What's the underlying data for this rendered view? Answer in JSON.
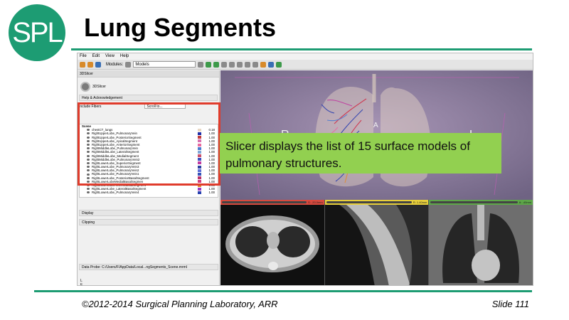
{
  "slide": {
    "logo_text": "SPL",
    "title": "Lung Segments",
    "footer_left": "©2012-2014 Surgical Planning Laboratory, ARR",
    "footer_right": "Slide 111"
  },
  "callout": {
    "text": "Slicer displays the list of 15 surface models of pulmonary structures."
  },
  "app": {
    "menu": [
      "File",
      "Edit",
      "View",
      "Help"
    ],
    "toolbar": {
      "modules_label": "Modules:",
      "module_selected": "Models"
    },
    "left_panel": {
      "header": "3DSlicer",
      "module_logo_label": "3DSlicer",
      "help_section": "Help & Acknowledgement",
      "filter_label": "Include Fibers",
      "filter_placeholder": "Scroll to...",
      "models": [
        {
          "name": "Scene",
          "opacity": "",
          "color": ""
        },
        {
          "name": "chestCT_lungs",
          "opacity": "0.18",
          "color": "#e8d7c4"
        },
        {
          "name": "RightUpperLobe_PulmonaryVein",
          "opacity": "1.00",
          "color": "#1f2fa8"
        },
        {
          "name": "RightUpperLobe_PosteriorSegment",
          "opacity": "1.00",
          "color": "#c23c3c"
        },
        {
          "name": "RightUpperLobe_ApicalSegment",
          "opacity": "1.00",
          "color": "#d870b0"
        },
        {
          "name": "RightUpperLobe_AnteriorSegment",
          "opacity": "1.00",
          "color": "#e86aa0"
        },
        {
          "name": "RightMiddleLobe_PulmonaryVein",
          "opacity": "1.00",
          "color": "#4a7bd0"
        },
        {
          "name": "RightMiddleLobe_LateralSegment",
          "opacity": "1.00",
          "color": "#7fa8d8"
        },
        {
          "name": "RightMiddleLobe_MedialSegment",
          "opacity": "1.00",
          "color": "#c9506c"
        },
        {
          "name": "RightMiddleLobe_PulmonaryVein2",
          "opacity": "1.00",
          "color": "#3b4fc0"
        },
        {
          "name": "RightLowerLobe_SuperiorSegment",
          "opacity": "1.00",
          "color": "#c03aa0"
        },
        {
          "name": "RightLowerLobe_PulmonaryVein3",
          "opacity": "1.00",
          "color": "#2d3fa0"
        },
        {
          "name": "RightLowerLobe_PulmonaryVein2",
          "opacity": "1.00",
          "color": "#5d6fd8"
        },
        {
          "name": "RightLowerLobe_PulmonaryVein1",
          "opacity": "1.00",
          "color": "#3552b8"
        },
        {
          "name": "RightLowerLobe_PosteriorBasalSegment",
          "opacity": "1.00",
          "color": "#b8306a"
        },
        {
          "name": "RightLowerLobeMedialBasalSegmen",
          "opacity": "1.00",
          "color": "#d0407e"
        },
        {
          "name": "RightLowerLobeAnteriorBasalSegment",
          "opacity": "1.00",
          "color": "#e28a2e"
        },
        {
          "name": "RightLowerLobe_LateralBasalSegment",
          "opacity": "1.00",
          "color": "#9d3ac2"
        },
        {
          "name": "RightLowerLobe_PulmonaryVein4",
          "opacity": "1.00",
          "color": "#2840b0"
        }
      ],
      "display_section": "Display",
      "clipping_section": "Clipping",
      "data_probe": "Data Probe: C:/Users/F/AppData/Local...ngSegments_Scene.mrml",
      "probe_values": [
        "L",
        "F",
        "I"
      ]
    },
    "view3d": {
      "label_right": "R",
      "label_anterior": "A",
      "label_left": "L"
    },
    "slices": [
      {
        "color": "red",
        "readout": "S: -20.0mm"
      },
      {
        "color": "yellow",
        "readout": "R: 1.40mm"
      },
      {
        "color": "green",
        "readout": "A: -40mm"
      }
    ]
  }
}
